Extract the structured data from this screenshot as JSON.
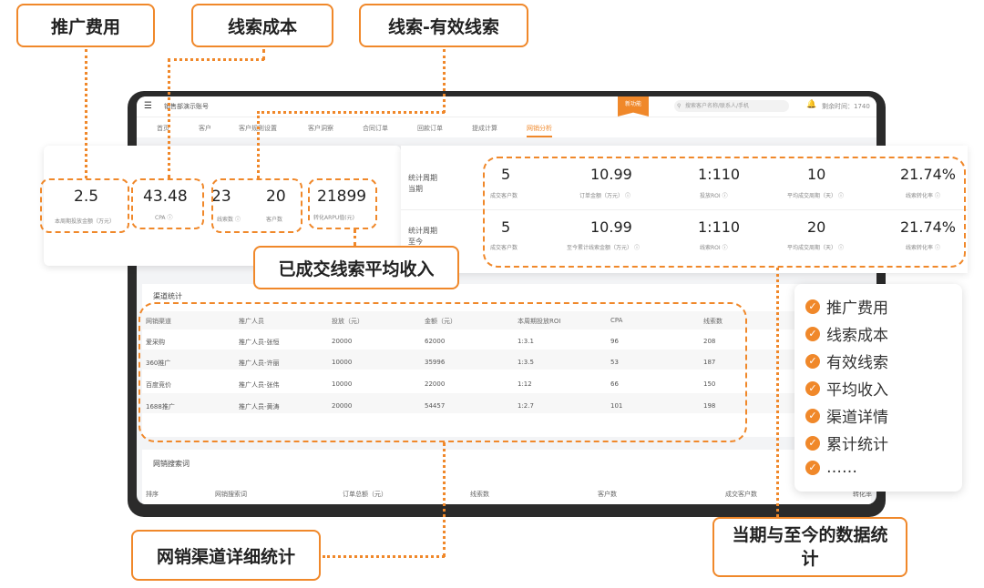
{
  "callouts": {
    "promotion_fee": "推广费用",
    "lead_cost": "线索成本",
    "valid_leads": "线索-有效线索",
    "avg_income": "已成交线索平均收入",
    "channel_detail": "网销渠道详细统计",
    "period_stats": "当期与至今的数据统计"
  },
  "app": {
    "menu_icon": "hamburger-icon",
    "title": "销售部演示账号",
    "ribbon": "新功能",
    "search_placeholder": "搜索客户名称/联系人/手机",
    "bell_icon": "bell-icon",
    "user_info": "剩余时间：1740"
  },
  "nav": {
    "tabs": [
      "首页",
      "客户",
      "客户规则设置",
      "客户洞察",
      "合同订单",
      "回款订单",
      "提成计算",
      "网销分析"
    ],
    "active_index": 7
  },
  "left_stats": [
    {
      "value": "2.5",
      "label": "本周期投放金额（万元）"
    },
    {
      "value": "43.48",
      "label": "CPA"
    },
    {
      "value": "23",
      "label": "线索数"
    },
    {
      "value": "20",
      "label": "客户数"
    },
    {
      "value": "21899",
      "label": "转化ARPU值(元)"
    }
  ],
  "period": {
    "current_label": "统计周期\n当期",
    "total_label": "统计周期\n至今",
    "current": [
      {
        "value": "5",
        "label": "成交客户数"
      },
      {
        "value": "10.99",
        "label": "订单金额（万元）"
      },
      {
        "value": "1:110",
        "label": "投放ROI"
      },
      {
        "value": "10",
        "label": "平均成交周期（天）"
      },
      {
        "value": "21.74%",
        "label": "线索转化率"
      }
    ],
    "total": [
      {
        "value": "5",
        "label": "成交客户数"
      },
      {
        "value": "10.99",
        "label": "至今累计线索金额（万元）"
      },
      {
        "value": "1:110",
        "label": "线索ROI"
      },
      {
        "value": "20",
        "label": "平均成交周期（天）"
      },
      {
        "value": "21.74%",
        "label": "线索转化率"
      }
    ]
  },
  "channel_table": {
    "title": "渠道统计",
    "headers": [
      "网销渠道",
      "推广人员",
      "投放（元）",
      "金额（元）",
      "本周期投放ROI",
      "CPA",
      "线索数"
    ],
    "rows": [
      [
        "爱采购",
        "推广人员-张恒",
        "20000",
        "62000",
        "1:3.1",
        "96",
        "208"
      ],
      [
        "360推广",
        "推广人员-许丽",
        "10000",
        "35996",
        "1:3.5",
        "53",
        "187"
      ],
      [
        "百度竞价",
        "推广人员-张伟",
        "10000",
        "22000",
        "1:12",
        "66",
        "150"
      ],
      [
        "1688推广",
        "推广人员-黄涛",
        "20000",
        "54457",
        "1:2.7",
        "101",
        "198"
      ]
    ]
  },
  "keyword_table": {
    "title": "网销搜索词",
    "headers": [
      "排序",
      "网销搜索词",
      "订单总额（元）",
      "线索数",
      "客户数",
      "成交客户数",
      "转化率"
    ]
  },
  "checklist": {
    "items": [
      "推广费用",
      "线索成本",
      "有效线索",
      "平均收入",
      "渠道详情",
      "累计统计",
      "……"
    ]
  },
  "colors": {
    "accent": "#f0882a"
  }
}
